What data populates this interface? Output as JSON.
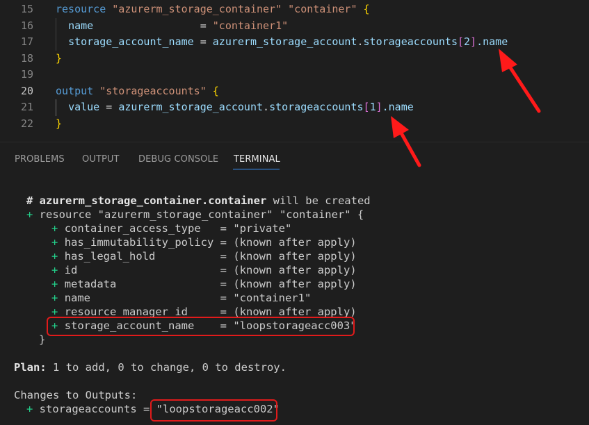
{
  "editor": {
    "lines": [
      {
        "num": "15",
        "active": false
      },
      {
        "num": "16",
        "active": false
      },
      {
        "num": "17",
        "active": false
      },
      {
        "num": "18",
        "active": false
      },
      {
        "num": "19",
        "active": false
      },
      {
        "num": "20",
        "active": true
      },
      {
        "num": "21",
        "active": false
      },
      {
        "num": "22",
        "active": false
      }
    ],
    "l15": {
      "kw": "resource",
      "s1": "\"azurerm_storage_container\"",
      "s2": "\"container\"",
      "brace": "{"
    },
    "l16": {
      "key": "name",
      "eq": "=",
      "val": "\"container1\""
    },
    "l17": {
      "key": "storage_account_name",
      "eq": "=",
      "ref": "azurerm_storage_account",
      "dot": ".",
      "ref2": "storageaccounts",
      "lb": "[",
      "idx": "2",
      "rb": "]",
      "tail": ".name"
    },
    "l18": {
      "brace": "}"
    },
    "l20": {
      "kw": "output",
      "s1": "\"storageaccounts\"",
      "brace": "{"
    },
    "l21": {
      "key": "value",
      "eq": "=",
      "ref": "azurerm_storage_account",
      "dot": ".",
      "ref2": "storageaccounts",
      "lb": "[",
      "idx": "1",
      "rb": "]",
      "tail": ".name"
    },
    "l22": {
      "brace": "}"
    }
  },
  "panel": {
    "tabs": [
      "PROBLEMS",
      "OUTPUT",
      "DEBUG CONSOLE",
      "TERMINAL"
    ],
    "active_tab": "TERMINAL"
  },
  "terminal": {
    "header_hash": "# ",
    "header_res": "azurerm_storage_container.container",
    "header_tail": " will be created",
    "res_plus": "+",
    "res_line": " resource \"azurerm_storage_container\" \"container\" {",
    "attrs": [
      {
        "plus": "+",
        "name": "container_access_type   ",
        "value": "= \"private\""
      },
      {
        "plus": "+",
        "name": "has_immutability_policy ",
        "value": "= (known after apply)"
      },
      {
        "plus": "+",
        "name": "has_legal_hold          ",
        "value": "= (known after apply)"
      },
      {
        "plus": "+",
        "name": "id                      ",
        "value": "= (known after apply)"
      },
      {
        "plus": "+",
        "name": "metadata                ",
        "value": "= (known after apply)"
      },
      {
        "plus": "+",
        "name": "name                    ",
        "value": "= \"container1\""
      },
      {
        "plus": "+",
        "name": "resource_manager_id     ",
        "value": "= (known after apply)"
      },
      {
        "plus": "+",
        "name": "storage_account_name    ",
        "value": "= \"loopstorageacc003\""
      }
    ],
    "close_brace": "}",
    "plan_label": "Plan:",
    "plan_text": " 1 to add, 0 to change, 0 to destroy.",
    "outputs_header": "Changes to Outputs:",
    "out_plus": "+",
    "out_name": " storageaccounts = ",
    "out_value": "\"loopstorageacc002\""
  },
  "colors": {
    "highlight": "#e11b1b",
    "arrow": "#ff1a1a",
    "accent": "#3794ff"
  }
}
